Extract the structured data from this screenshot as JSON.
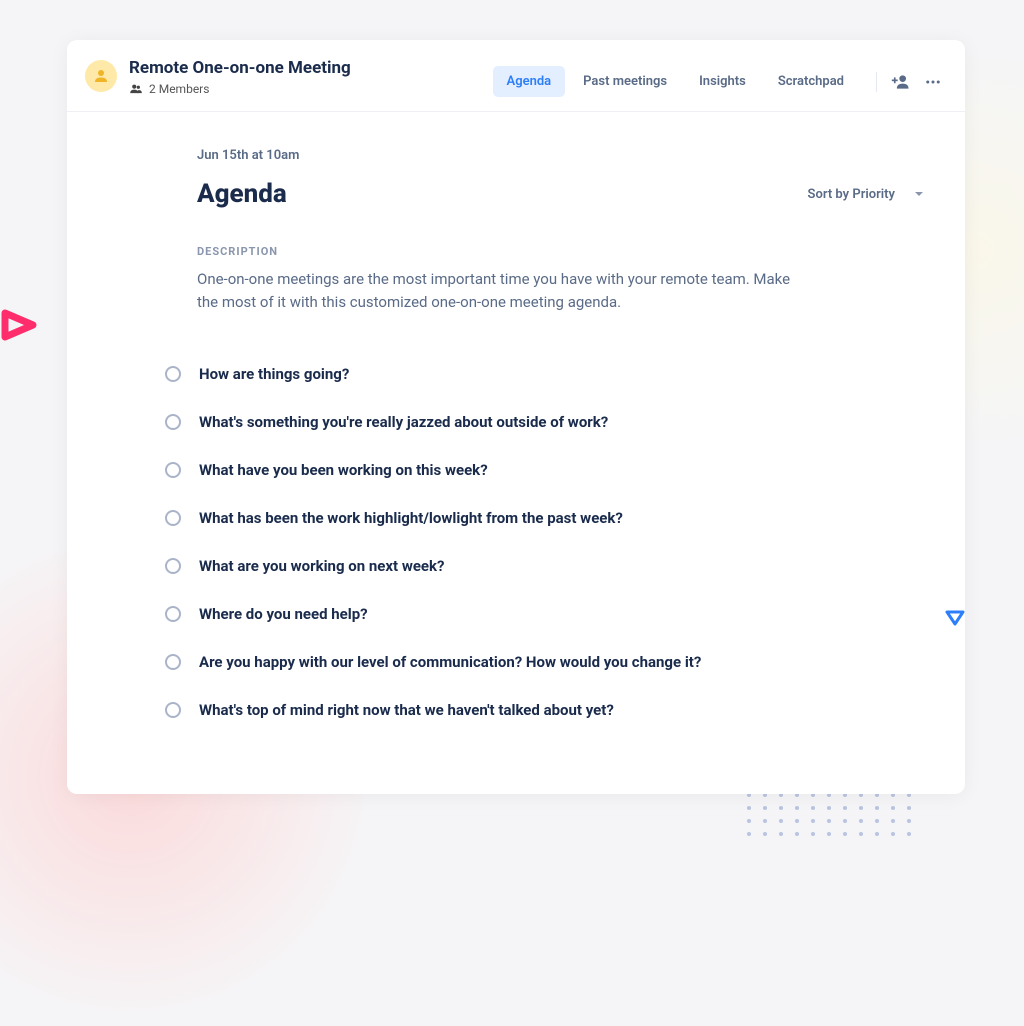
{
  "header": {
    "title": "Remote One-on-one Meeting",
    "members_label": "2 Members"
  },
  "tabs": [
    {
      "label": "Agenda",
      "active": true
    },
    {
      "label": "Past meetings",
      "active": false
    },
    {
      "label": "Insights",
      "active": false
    },
    {
      "label": "Scratchpad",
      "active": false
    }
  ],
  "meta": {
    "datetime": "Jun 15th at 10am",
    "page_title": "Agenda",
    "sort_label": "Sort by Priority",
    "description_label": "DESCRIPTION",
    "description_text": "One-on-one meetings are the most important time you have with your remote team. Make the most of it with this customized one-on-one meeting agenda."
  },
  "items": [
    {
      "text": "How are things going?"
    },
    {
      "text": "What's something you're really jazzed about outside of work?"
    },
    {
      "text": "What have you been working on this week?"
    },
    {
      "text": "What has been the work highlight/lowlight from the past week?"
    },
    {
      "text": "What are you working on next week?"
    },
    {
      "text": "Where do you need help?"
    },
    {
      "text": "Are you happy with our level of communication? How would you change it?"
    },
    {
      "text": "What's top of mind right now that we haven't talked about yet?"
    }
  ]
}
